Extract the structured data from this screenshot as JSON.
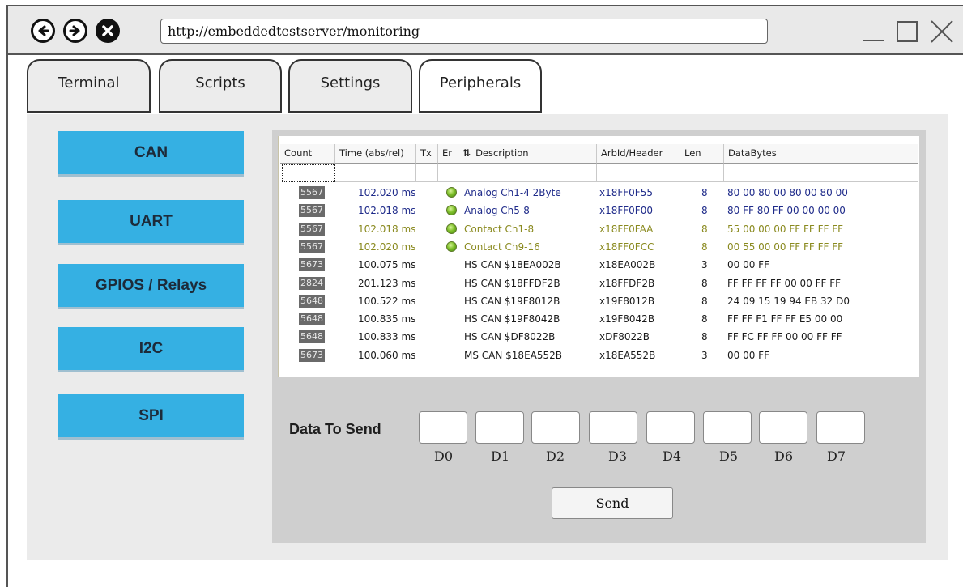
{
  "browser": {
    "url": "http://embeddedtestserver/monitoring",
    "nav_icons": [
      "back-icon",
      "forward-icon",
      "close-icon"
    ],
    "window_icons": [
      "minimize-icon",
      "maximize-icon",
      "close-window-icon"
    ]
  },
  "tabs": [
    {
      "label": "Terminal",
      "active": false
    },
    {
      "label": "Scripts",
      "active": false
    },
    {
      "label": "Settings",
      "active": false
    },
    {
      "label": "Peripherals",
      "active": true
    }
  ],
  "sidebar": {
    "items": [
      {
        "label": "CAN"
      },
      {
        "label": "UART"
      },
      {
        "label": "GPIOS / Relays"
      },
      {
        "label": "I2C"
      },
      {
        "label": "SPI"
      }
    ]
  },
  "table": {
    "columns": [
      "Count",
      "Time (abs/rel)",
      "Tx",
      "Er",
      "Description",
      "ArbId/Header",
      "Len",
      "DataBytes"
    ],
    "sort_icon": "sort-az-icon",
    "rows": [
      {
        "count": "5567",
        "time": "102.020 ms",
        "tx": true,
        "desc": "Analog Ch1-4 2Byte",
        "arbid": "x18FF0F55",
        "len": "8",
        "data": "80 00 80 00 80 00 80 00",
        "color": "#1f2b8a"
      },
      {
        "count": "5567",
        "time": "102.018 ms",
        "tx": true,
        "desc": "Analog Ch5-8",
        "arbid": "x18FF0F00",
        "len": "8",
        "data": "80 FF 80 FF 00 00 00 00",
        "color": "#1f2b8a"
      },
      {
        "count": "5567",
        "time": "102.018 ms",
        "tx": true,
        "desc": "Contact Ch1-8",
        "arbid": "x18FF0FAA",
        "len": "8",
        "data": "55 00 00 00 FF FF FF FF",
        "color": "#8a8a1f"
      },
      {
        "count": "5567",
        "time": "102.020 ms",
        "tx": true,
        "desc": "Contact Ch9-16",
        "arbid": "x18FF0FCC",
        "len": "8",
        "data": "00 55 00 00 FF FF FF FF",
        "color": "#8a8a1f"
      },
      {
        "count": "5673",
        "time": "100.075 ms",
        "tx": false,
        "desc": "HS CAN $18EA002B",
        "arbid": "x18EA002B",
        "len": "3",
        "data": "00 00 FF",
        "color": "#1a1a1a"
      },
      {
        "count": "2824",
        "time": "201.123 ms",
        "tx": false,
        "desc": "HS CAN $18FFDF2B",
        "arbid": "x18FFDF2B",
        "len": "8",
        "data": "FF FF FF FF 00 00 FF FF",
        "color": "#1a1a1a"
      },
      {
        "count": "5648",
        "time": "100.522 ms",
        "tx": false,
        "desc": "HS CAN $19F8012B",
        "arbid": "x19F8012B",
        "len": "8",
        "data": "24 09 15 19 94 EB 32 D0",
        "color": "#1a1a1a"
      },
      {
        "count": "5648",
        "time": "100.835 ms",
        "tx": false,
        "desc": "HS CAN $19F8042B",
        "arbid": "x19F8042B",
        "len": "8",
        "data": "FF FF F1 FF FF E5 00 00",
        "color": "#1a1a1a"
      },
      {
        "count": "5648",
        "time": "100.833 ms",
        "tx": false,
        "desc": "HS CAN $DF8022B",
        "arbid": "xDF8022B",
        "len": "8",
        "data": "FF FC FF FF 00 00 FF FF",
        "color": "#1a1a1a"
      },
      {
        "count": "5673",
        "time": "100.060 ms",
        "tx": false,
        "desc": "MS CAN $18EA552B",
        "arbid": "x18EA552B",
        "len": "3",
        "data": "00 00 FF",
        "color": "#1a1a1a"
      }
    ]
  },
  "send_panel": {
    "label": "Data To Send",
    "fields": [
      "D0",
      "D1",
      "D2",
      "D3",
      "D4",
      "D5",
      "D6",
      "D7"
    ],
    "values": [
      "",
      "",
      "",
      "",
      "",
      "",
      "",
      ""
    ],
    "button": "Send"
  },
  "colors": {
    "sidebar_button": "#35b0e3",
    "panel_bg": "#cfcfcf",
    "content_bg": "#ebebeb"
  }
}
